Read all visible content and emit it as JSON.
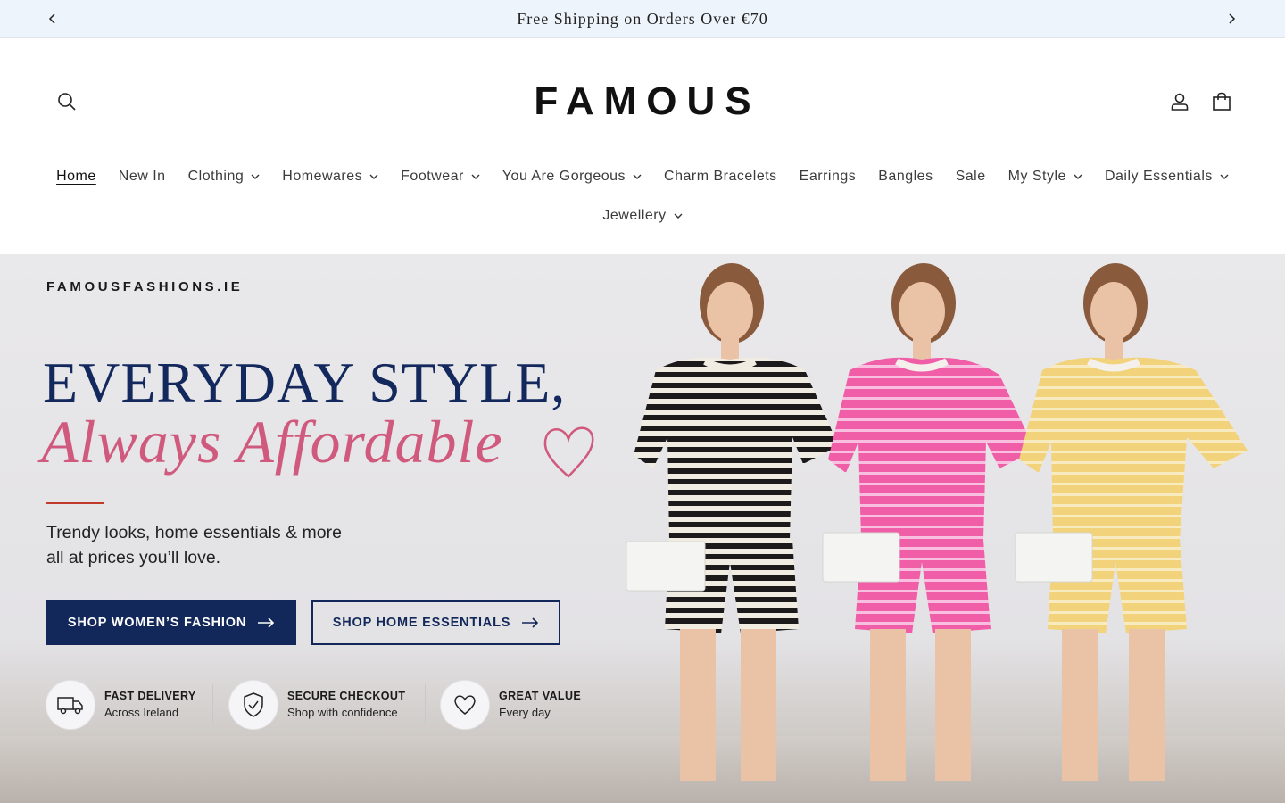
{
  "announcement": {
    "text": "Free Shipping on Orders Over €70",
    "prev_icon": "chevron-left-icon",
    "next_icon": "chevron-right-icon"
  },
  "header": {
    "logo": "FAMOUS",
    "search_icon": "search-icon",
    "account_icon": "user-icon",
    "cart_icon": "shopping-bag-icon"
  },
  "nav": {
    "row1": [
      {
        "label": "Home",
        "active": true,
        "dropdown": false
      },
      {
        "label": "New In",
        "active": false,
        "dropdown": false
      },
      {
        "label": "Clothing",
        "active": false,
        "dropdown": true
      },
      {
        "label": "Homewares",
        "active": false,
        "dropdown": true
      },
      {
        "label": "Footwear",
        "active": false,
        "dropdown": true
      },
      {
        "label": "You Are Gorgeous",
        "active": false,
        "dropdown": true
      },
      {
        "label": "Charm Bracelets",
        "active": false,
        "dropdown": false
      },
      {
        "label": "Earrings",
        "active": false,
        "dropdown": false
      },
      {
        "label": "Bangles",
        "active": false,
        "dropdown": false
      },
      {
        "label": "Sale",
        "active": false,
        "dropdown": false
      },
      {
        "label": "My Style",
        "active": false,
        "dropdown": true
      },
      {
        "label": "Daily Essentials",
        "active": false,
        "dropdown": true
      }
    ],
    "row2": [
      {
        "label": "Jewellery",
        "active": false,
        "dropdown": true
      }
    ]
  },
  "hero": {
    "brand_url": "FAMOUSFASHIONS.IE",
    "headline": "EVERYDAY STYLE,",
    "script_line": "Always Affordable",
    "tagline_line1": "Trendy looks, home essentials & more",
    "tagline_line2": "all at prices you’ll love.",
    "primary_button": "SHOP WOMEN’S FASHION",
    "secondary_button": "SHOP HOME ESSENTIALS",
    "features": [
      {
        "icon": "truck-icon",
        "title": "FAST DELIVERY",
        "subtitle": "Across Ireland"
      },
      {
        "icon": "shield-check-icon",
        "title": "SECURE CHECKOUT",
        "subtitle": "Shop with confidence"
      },
      {
        "icon": "heart-icon",
        "title": "GREAT VALUE",
        "subtitle": "Every day"
      }
    ],
    "colors": {
      "navy": "#12275a",
      "pink_script": "#d05a7e",
      "accent_line": "#c0392b"
    }
  }
}
